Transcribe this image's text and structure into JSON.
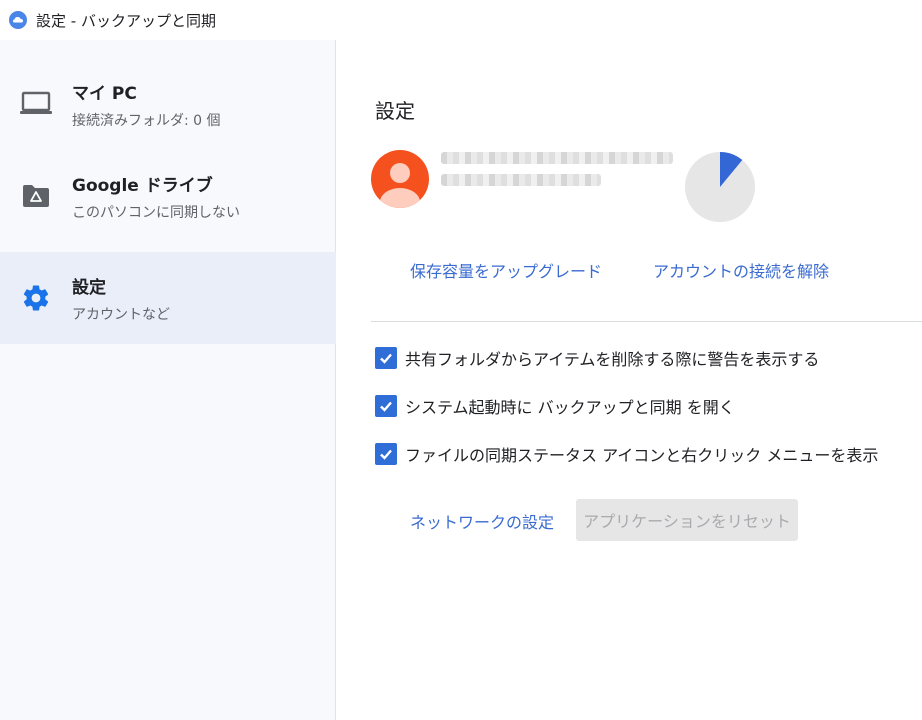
{
  "window": {
    "title": "設定 - バックアップと同期"
  },
  "sidebar": {
    "items": [
      {
        "label": "マイ PC",
        "sub": "接続済みフォルダ: 0 個",
        "icon": "laptop-icon"
      },
      {
        "label": "Google ドライブ",
        "sub": "このパソコンに同期しない",
        "icon": "drive-folder-icon"
      },
      {
        "label": "設定",
        "sub": "アカウントなど",
        "icon": "gear-icon",
        "active": true
      }
    ]
  },
  "main": {
    "title": "設定",
    "storage": {
      "used_fraction": 0.11
    },
    "links": {
      "upgrade": "保存容量をアップグレード",
      "disconnect": "アカウントの接続を解除",
      "network": "ネットワークの設定"
    },
    "checkboxes": [
      {
        "label": "共有フォルダからアイテムを削除する際に警告を表示する",
        "checked": true
      },
      {
        "label": "システム起動時に バックアップと同期 を開く",
        "checked": true
      },
      {
        "label": "ファイルの同期ステータス アイコンと右クリック メニューを表示",
        "checked": true
      }
    ],
    "reset_button": "アプリケーションをリセット"
  },
  "colors": {
    "accent": "#3a6bd0",
    "checkbox": "#2f6ed6",
    "avatar": "#f4511e",
    "sidebar_active": "#eaeef8",
    "pie_used": "#3367d6",
    "pie_free": "#e6e6e6"
  }
}
